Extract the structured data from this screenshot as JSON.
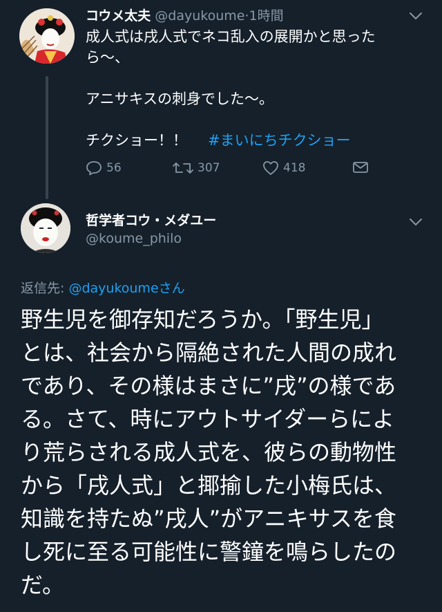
{
  "tweet1": {
    "display_name": "コウメ太夫",
    "handle": "@dayukoume",
    "separator": "·",
    "time": "1時間",
    "body_lines": [
      "成人式は戌人式でネコ乱入の展開かと思った",
      "ら〜、"
    ],
    "body_line2": "アニサキスの刺身でした〜。",
    "body_line3_text": "チクショー！！",
    "hashtag": "#まいにちチクショー",
    "replies": "56",
    "retweets": "307",
    "likes": "418",
    "icons": [
      "reply-icon",
      "retweet-icon",
      "like-icon",
      "direct-message-icon",
      "chevron-down-icon"
    ]
  },
  "tweet2": {
    "display_name": "哲学者コウ・メダユー",
    "handle": "@koume_philo",
    "reply_label": "返信先:",
    "reply_mention": "@dayukoume",
    "reply_suffix": "さん",
    "body_lines": [
      "野生児を御存知だろうか。「野生児」",
      "とは、社会から隔絶された人間の成れ",
      "であり、その様はまさに”戌”の様であ",
      "る。さて、時にアウトサイダーらによ",
      "り荒らされる成人式を、彼らの動物性",
      "から「戌人式」と揶揄した小梅氏は、",
      "知識を持たぬ”戌人”がアニキサスを食",
      "し死に至る可能性に警鐘を鳴らしたの",
      "だ。"
    ]
  },
  "colors": {
    "background": "#15202b",
    "text": "#ffffff",
    "muted": "#8899a6",
    "link": "#1da1f2",
    "thread_line": "#38444d"
  }
}
